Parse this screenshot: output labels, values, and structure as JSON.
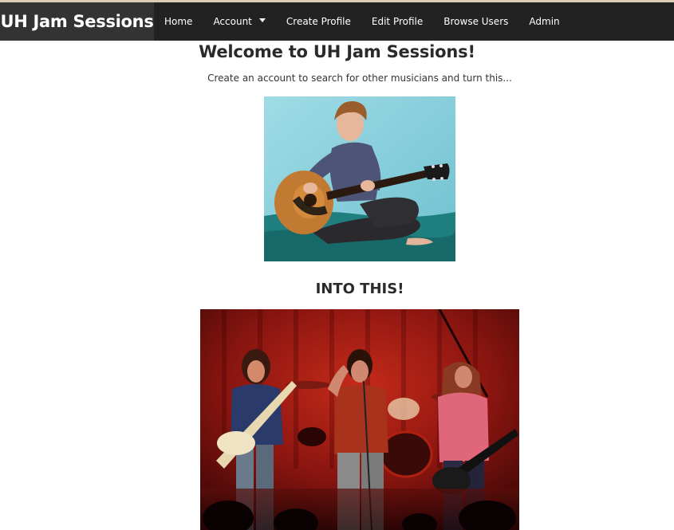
{
  "navbar": {
    "brand": "UH Jam Sessions",
    "items": [
      {
        "label": "Home"
      },
      {
        "label": "Account"
      },
      {
        "label": "Create Profile"
      },
      {
        "label": "Edit Profile"
      },
      {
        "label": "Browse Users"
      },
      {
        "label": "Admin"
      }
    ]
  },
  "main": {
    "title": "Welcome to UH Jam Sessions!",
    "subtitle": "Create an account to search for other musicians and turn this...",
    "into_heading": "INTO THIS!"
  },
  "colors": {
    "navbar_bg": "#222222",
    "brand_bg": "#333333",
    "photo1_bg": "#8fd4de",
    "photo2_bg": "#6a1010"
  },
  "icons": {
    "account_dropdown": "caret-down-icon"
  }
}
